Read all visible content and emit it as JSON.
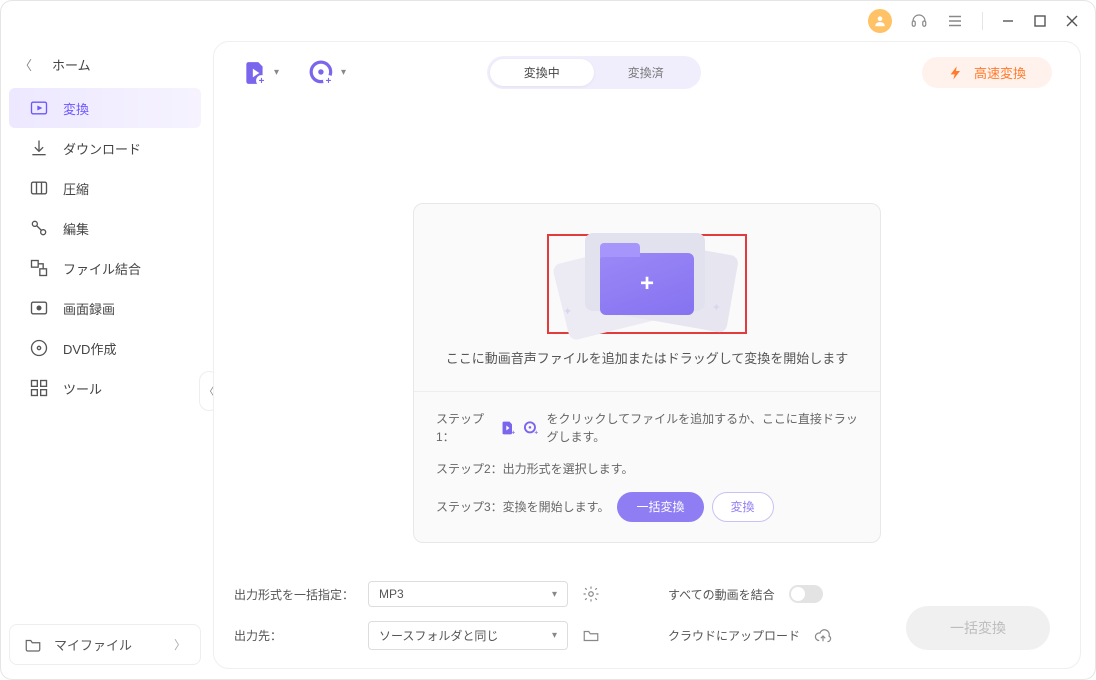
{
  "titlebar": {},
  "home": {
    "label": "ホーム"
  },
  "sidebar": {
    "items": [
      {
        "label": "変換"
      },
      {
        "label": "ダウンロード"
      },
      {
        "label": "圧縮"
      },
      {
        "label": "編集"
      },
      {
        "label": "ファイル結合"
      },
      {
        "label": "画面録画"
      },
      {
        "label": "DVD作成"
      },
      {
        "label": "ツール"
      }
    ],
    "myfiles": "マイファイル"
  },
  "toolbar": {
    "tabs": {
      "active": "変換中",
      "inactive": "変換済"
    },
    "fast": "高速変換"
  },
  "dropzone": {
    "message": "ここに動画音声ファイルを追加またはドラッグして変換を開始します",
    "step1_prefix": "ステップ1：",
    "step1_suffix": " をクリックしてファイルを追加するか、ここに直接ドラッグします。",
    "step2": "ステップ2：出力形式を選択します。",
    "step3": "ステップ3：変換を開始します。",
    "btn_batch": "一括変換",
    "btn_convert": "変換"
  },
  "footer": {
    "format_label": "出力形式を一括指定：",
    "format_value": "MP3",
    "output_label": "出力先：",
    "output_value": "ソースフォルダと同じ",
    "merge_label": "すべての動画を結合",
    "cloud_label": "クラウドにアップロード",
    "big_button": "一括変換"
  }
}
